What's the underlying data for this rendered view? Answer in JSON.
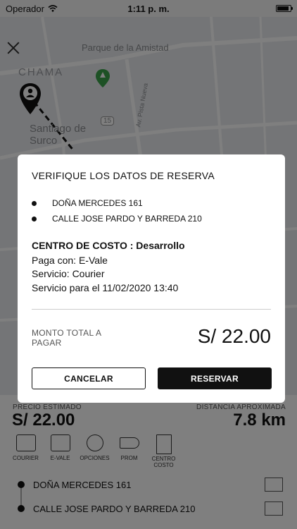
{
  "status_bar": {
    "carrier": "Operador",
    "time": "1:11 p. m."
  },
  "map": {
    "labels": [
      "Parque de la Amistad",
      "CHAMA",
      "Santiago de Surco",
      "Av. Pista Nueva",
      "15"
    ]
  },
  "panel": {
    "price_caption": "PRECIO ESTIMADO",
    "price_value": "S/ 22.00",
    "distance_caption": "DISTANCIA APROXIMADA",
    "distance_value": "7.8 km",
    "options": [
      {
        "label": "COURIER",
        "icon": "truck-icon"
      },
      {
        "label": "E-VALE",
        "icon": "voucher-icon"
      },
      {
        "label": "OPCIONES",
        "icon": "gear-icon"
      },
      {
        "label": "PROM",
        "icon": "tag-icon"
      },
      {
        "label": "CENTRO COSTO",
        "icon": "building-icon"
      }
    ],
    "route": [
      "DOÑA MERCEDES 161",
      "CALLE JOSE PARDO Y BARREDA 210"
    ]
  },
  "dialog": {
    "title": "VERIFIQUE LOS DATOS DE RESERVA",
    "addresses": [
      "DOÑA MERCEDES 161",
      "CALLE JOSE PARDO Y BARREDA 210"
    ],
    "cost_center": "CENTRO DE COSTO : Desarrollo",
    "payment": "Paga con: E-Vale",
    "service": "Servicio: Courier",
    "service_for": "Servicio para el 11/02/2020 13:40",
    "total_caption": "MONTO TOTAL A PAGAR",
    "total_value": "S/ 22.00",
    "cancel_label": "CANCELAR",
    "confirm_label": "RESERVAR"
  }
}
